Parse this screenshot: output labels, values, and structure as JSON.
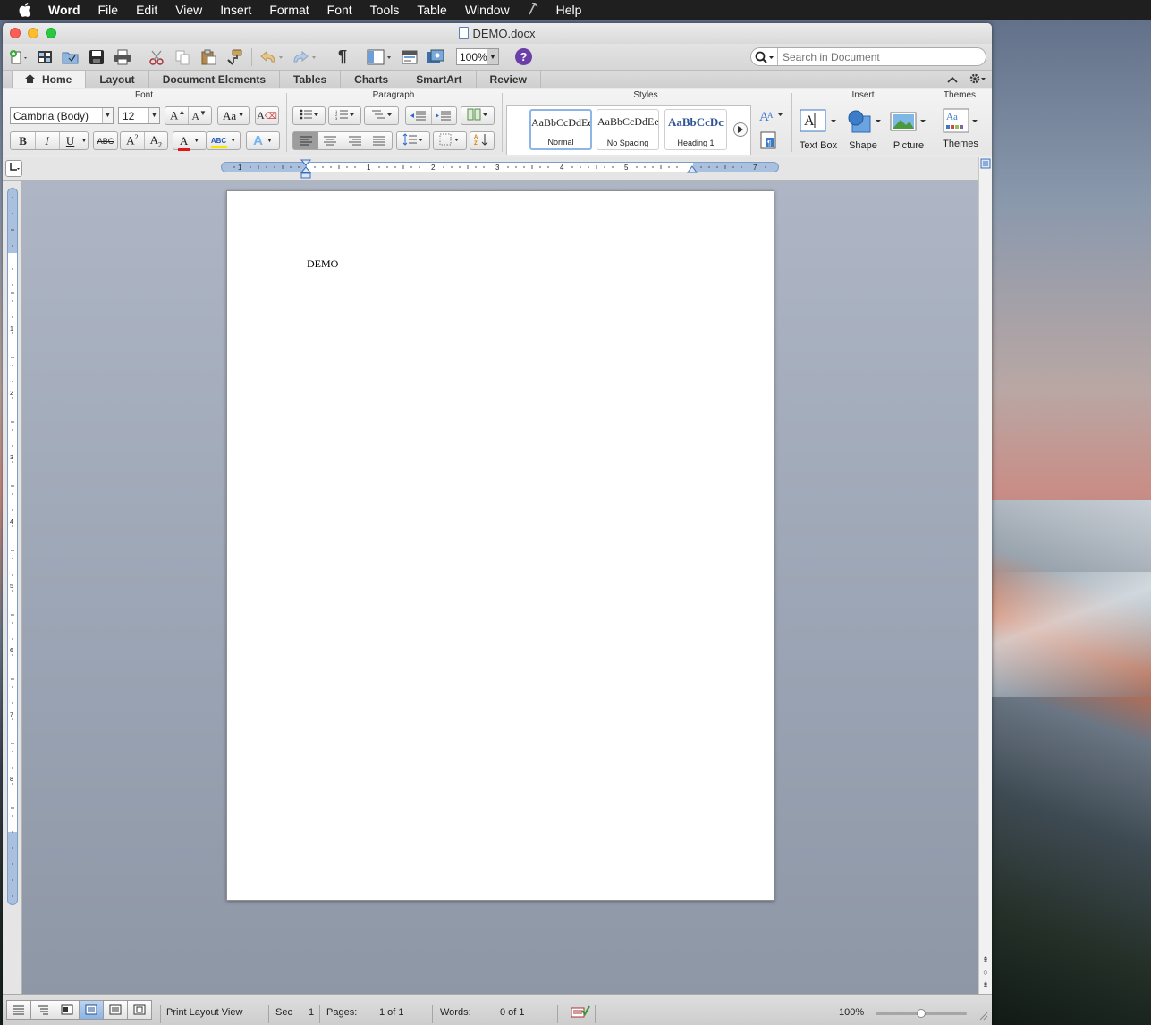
{
  "menubar": {
    "items": [
      "Word",
      "File",
      "Edit",
      "View",
      "Insert",
      "Format",
      "Font",
      "Tools",
      "Table",
      "Window",
      "Help"
    ]
  },
  "window": {
    "title": "DEMO.docx"
  },
  "toolbar": {
    "zoom": "100%",
    "search_placeholder": "Search in Document"
  },
  "ribbon": {
    "tabs": [
      "Home",
      "Layout",
      "Document Elements",
      "Tables",
      "Charts",
      "SmartArt",
      "Review"
    ],
    "groups": {
      "font": "Font",
      "paragraph": "Paragraph",
      "styles": "Styles",
      "insert": "Insert",
      "themes": "Themes"
    },
    "font_name": "Cambria (Body)",
    "font_size": "12",
    "styles": [
      {
        "preview": "AaBbCcDdEe",
        "name": "Normal"
      },
      {
        "preview": "AaBbCcDdEe",
        "name": "No Spacing"
      },
      {
        "preview": "AaBbCcDc",
        "name": "Heading 1"
      }
    ],
    "insert_items": [
      "Text Box",
      "Shape",
      "Picture"
    ],
    "themes_label": "Themes"
  },
  "ruler": {
    "h_numbers": [
      "1",
      "1",
      "2",
      "3",
      "4",
      "5",
      "7"
    ],
    "v_numbers": [
      "1",
      "2",
      "3",
      "4",
      "5",
      "6",
      "7",
      "8"
    ]
  },
  "document": {
    "body_text": "DEMO"
  },
  "statusbar": {
    "view": "Print Layout View",
    "sec_label": "Sec",
    "sec_value": "1",
    "pages_label": "Pages:",
    "pages_value": "1 of 1",
    "words_label": "Words:",
    "words_value": "0 of 1",
    "zoom": "100%"
  },
  "colors": {
    "accent": "#8db3e4",
    "font_color_bar": "#e0161b",
    "highlight_bar": "#f2e600",
    "help": "#6b3fa8"
  }
}
